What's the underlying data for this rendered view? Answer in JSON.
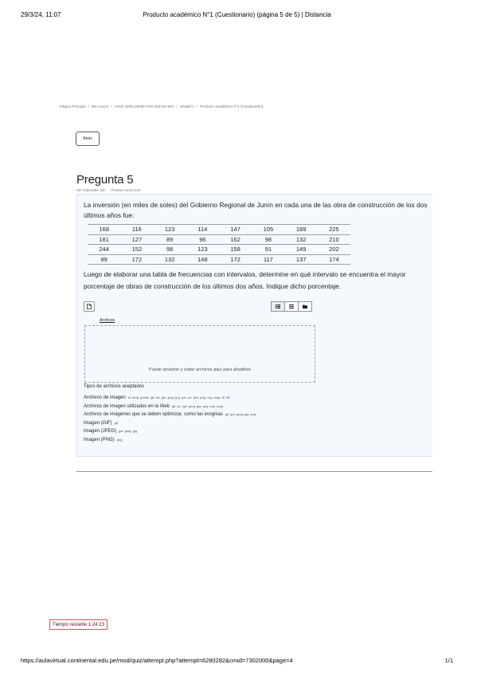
{
  "print_header": {
    "date": "29/3/24, 11:07",
    "title": "Producto académico N°1 (Cuestionario) (página 5 de 5) | Distancia"
  },
  "breadcrumb": [
    "Página Principal",
    "/",
    "Mis cursos",
    "/",
    "ASUC-0005-25189-VM1-202410-S01",
    "/",
    "Unidad 1",
    "/",
    "Producto académico N°1 (Cuestionario)"
  ],
  "back_button": "Atrás",
  "question": {
    "title": "Pregunta 5",
    "status": "Sin responder aún",
    "points": "Puntúa como 5,00",
    "text_1": "La inversión (en miles de soles) del Gobierno Regional de Junín en cada una de las obra de construcción de los dos últimos años fue:",
    "table": [
      [
        "168",
        "116",
        "123",
        "114",
        "147",
        "105",
        "189",
        "225"
      ],
      [
        "181",
        "127",
        "89",
        "96",
        "162",
        "98",
        "132",
        "210"
      ],
      [
        "244",
        "152",
        "98",
        "123",
        "158",
        "91",
        "149",
        "202"
      ],
      [
        "89",
        "172",
        "132",
        "148",
        "172",
        "117",
        "137",
        "174"
      ]
    ],
    "text_2": "Luego de elaborar una tabla de frecuencias con intervalos, determine en qué intervalo se encuentra el mayor porcentaje de obras de construcción de los últimos dos años. Indique dicho porcentaje."
  },
  "file_picker": {
    "files_label": "Archivos",
    "dropzone_text": "Puede arrastrar y soltar archivos aquí para añadirlos",
    "accepted_title": "Tipos de archivos aceptados",
    "accepted": [
      {
        "label": "Archivos de imagen",
        "ext": ".ai .bmp .gdraw .gif .ico .jpe .jpeg .jpg .pct .pic .pict .png .svg .svgz .tif .tiff"
      },
      {
        "label": "Archivos de imagen utilizados en la Web",
        "ext": ".gif .ico .jpe .jpeg .jpg .png .svg .svgz"
      },
      {
        "label": "Archivos de imágenes que se deben optimizar, como las insignias",
        "ext": ".gif .jpe .jpeg .jpg .png"
      },
      {
        "label": "Imagen (GIF)",
        "ext": ".gif"
      },
      {
        "label": "Imagen (JPEG)",
        "ext": ".jpe .jpeg .jpg"
      },
      {
        "label": "Imagen (PNG)",
        "ext": ".png"
      }
    ]
  },
  "timer": "Tiempo restante 1:24:23",
  "print_footer": {
    "url": "https://aulavirtual.continental.edu.pe/mod/quiz/attempt.php?attempt=6280282&cmid=7302000&page=4",
    "pages": "1/1"
  }
}
